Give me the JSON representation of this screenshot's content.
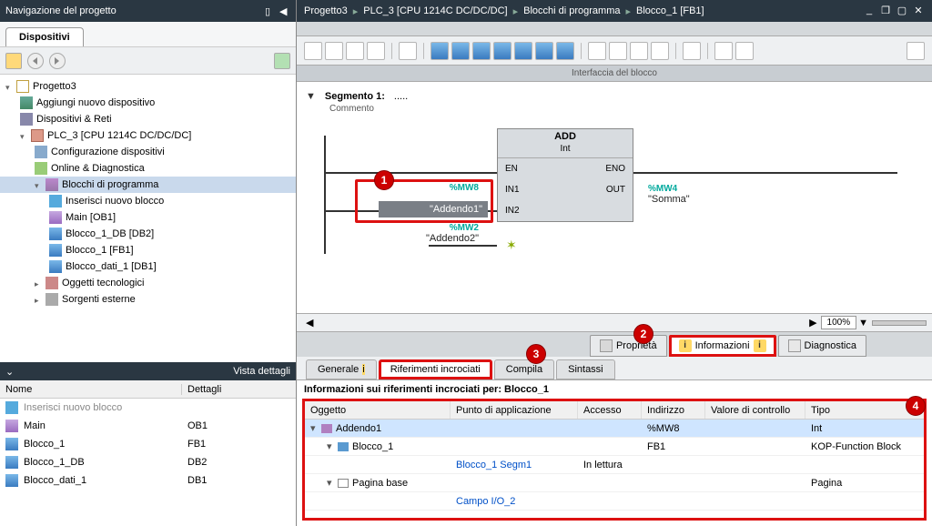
{
  "nav": {
    "title": "Navigazione del progetto",
    "tab": "Dispositivi"
  },
  "tree": {
    "project": "Progetto3",
    "addDevice": "Aggiungi nuovo dispositivo",
    "devicesNets": "Dispositivi & Reti",
    "plc": "PLC_3 [CPU 1214C DC/DC/DC]",
    "config": "Configurazione dispositivi",
    "online": "Online & Diagnostica",
    "blocks": "Blocchi di programma",
    "addBlock": "Inserisci nuovo blocco",
    "main": "Main [OB1]",
    "blocco1db": "Blocco_1_DB [DB2]",
    "blocco1": "Blocco_1 [FB1]",
    "bloccoDati": "Blocco_dati_1 [DB1]",
    "tech": "Oggetti tecnologici",
    "src": "Sorgenti esterne"
  },
  "detail": {
    "title": "Vista dettagli",
    "colName": "Nome",
    "colDetail": "Dettagli",
    "rows": [
      {
        "name": "Inserisci nuovo blocco",
        "detail": ""
      },
      {
        "name": "Main",
        "detail": "OB1"
      },
      {
        "name": "Blocco_1",
        "detail": "FB1"
      },
      {
        "name": "Blocco_1_DB",
        "detail": "DB2"
      },
      {
        "name": "Blocco_dati_1",
        "detail": "DB1"
      }
    ]
  },
  "breadcrumb": [
    "Progetto3",
    "PLC_3 [CPU 1214C DC/DC/DC]",
    "Blocchi di programma",
    "Blocco_1 [FB1]"
  ],
  "interfaceBar": "Interfaccia del blocco",
  "segment": {
    "label": "Segmento 1:",
    "dots": ".....",
    "comment": "Commento"
  },
  "ladder": {
    "boxTitle": "ADD",
    "boxType": "Int",
    "en": "EN",
    "eno": "ENO",
    "in1": "IN1",
    "in2": "IN2",
    "out": "OUT",
    "addr1": "%MW8",
    "name1": "\"Addendo1\"",
    "addr2": "%MW2",
    "name2": "\"Addendo2\"",
    "outAddr": "%MW4",
    "outName": "\"Somma\""
  },
  "zoom": "100%",
  "infoTabs": {
    "properties": "Proprietà",
    "info": "Informazioni",
    "diag": "Diagnostica"
  },
  "subTabs": {
    "general": "Generale",
    "xref": "Riferimenti incrociati",
    "compile": "Compila",
    "syntax": "Sintassi"
  },
  "xref": {
    "title": "Informazioni sui riferimenti incrociati per: Blocco_1",
    "cols": [
      "Oggetto",
      "Punto di applicazione",
      "Accesso",
      "Indirizzo",
      "Valore di controllo",
      "Tipo"
    ],
    "rows": [
      {
        "indent": 0,
        "toggle": true,
        "icon": "tag",
        "obj": "Addendo1",
        "app": "",
        "acc": "",
        "addr": "%MW8",
        "val": "",
        "type": "Int",
        "sel": true
      },
      {
        "indent": 1,
        "toggle": true,
        "icon": "block",
        "obj": "Blocco_1",
        "app": "",
        "acc": "",
        "addr": "FB1",
        "val": "",
        "type": "KOP-Function Block"
      },
      {
        "indent": 2,
        "toggle": false,
        "icon": "",
        "obj": "",
        "app": "Blocco_1 Segm1",
        "acc": "In lettura",
        "addr": "",
        "val": "",
        "type": "",
        "link": true
      },
      {
        "indent": 1,
        "toggle": true,
        "icon": "page",
        "obj": "Pagina base",
        "app": "",
        "acc": "",
        "addr": "",
        "val": "",
        "type": "Pagina"
      },
      {
        "indent": 2,
        "toggle": false,
        "icon": "",
        "obj": "",
        "app": "Campo I/O_2",
        "acc": "",
        "addr": "",
        "val": "",
        "type": "",
        "link": true
      }
    ]
  }
}
